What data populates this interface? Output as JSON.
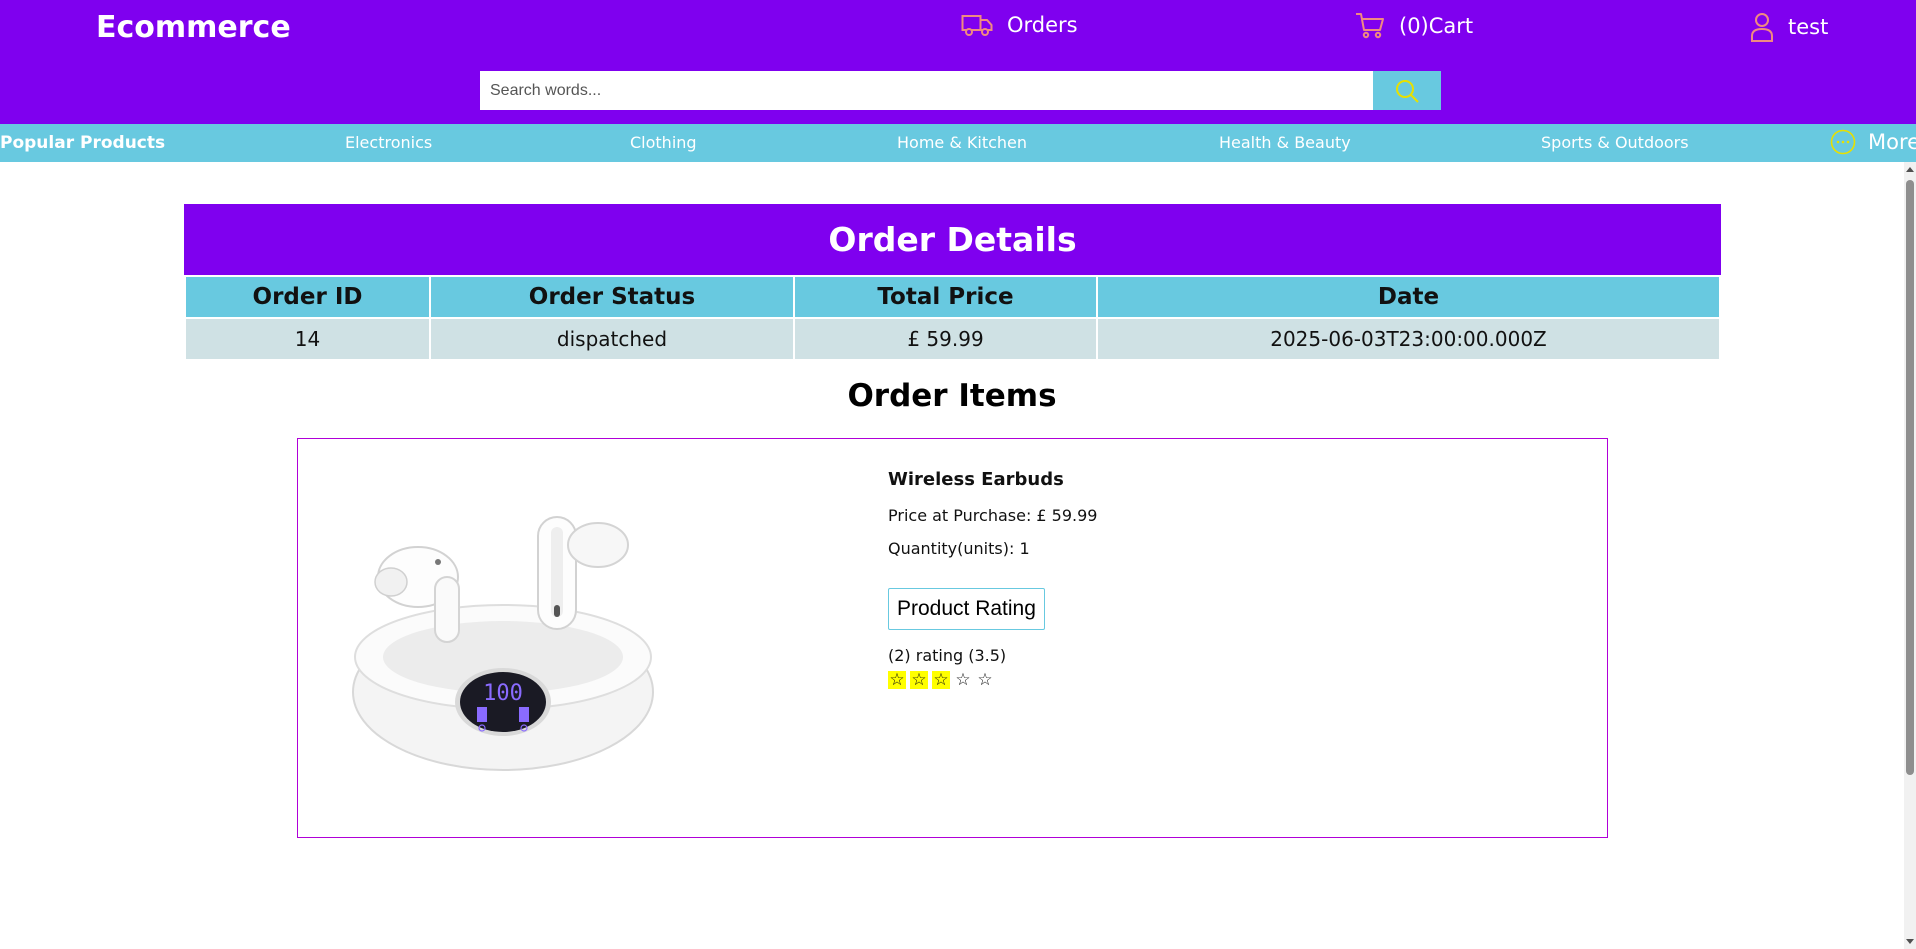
{
  "header": {
    "logo": "Ecommerce",
    "orders_label": "Orders",
    "cart_label": "(0)Cart",
    "user_label": "test",
    "search_placeholder": "Search words..."
  },
  "categories": {
    "popular": "Popular Products",
    "items": [
      "Electronics",
      "Clothing",
      "Home & Kitchen",
      "Health & Beauty",
      "Sports & Outdoors"
    ],
    "more": "More"
  },
  "order": {
    "title": "Order Details",
    "columns": [
      "Order ID",
      "Order Status",
      "Total Price",
      "Date"
    ],
    "row": [
      "14",
      "dispatched",
      "£ 59.99",
      "2025-06-03T23:00:00.000Z"
    ]
  },
  "items_section": {
    "title": "Order Items",
    "item": {
      "name": "Wireless Earbuds",
      "price": "Price at Purchase: £ 59.99",
      "quantity": "Quantity(units): 1",
      "rating_button": "Product Rating",
      "rating_text": "(2) rating (3.5)",
      "stars_filled": 3,
      "stars_total": 5,
      "earbuds_case_display": "100"
    }
  },
  "colors": {
    "primary": "#7f00ef",
    "accent": "#68c9e0",
    "row_bg": "#cfe1e4",
    "icon_yellow": "#e8e000"
  }
}
